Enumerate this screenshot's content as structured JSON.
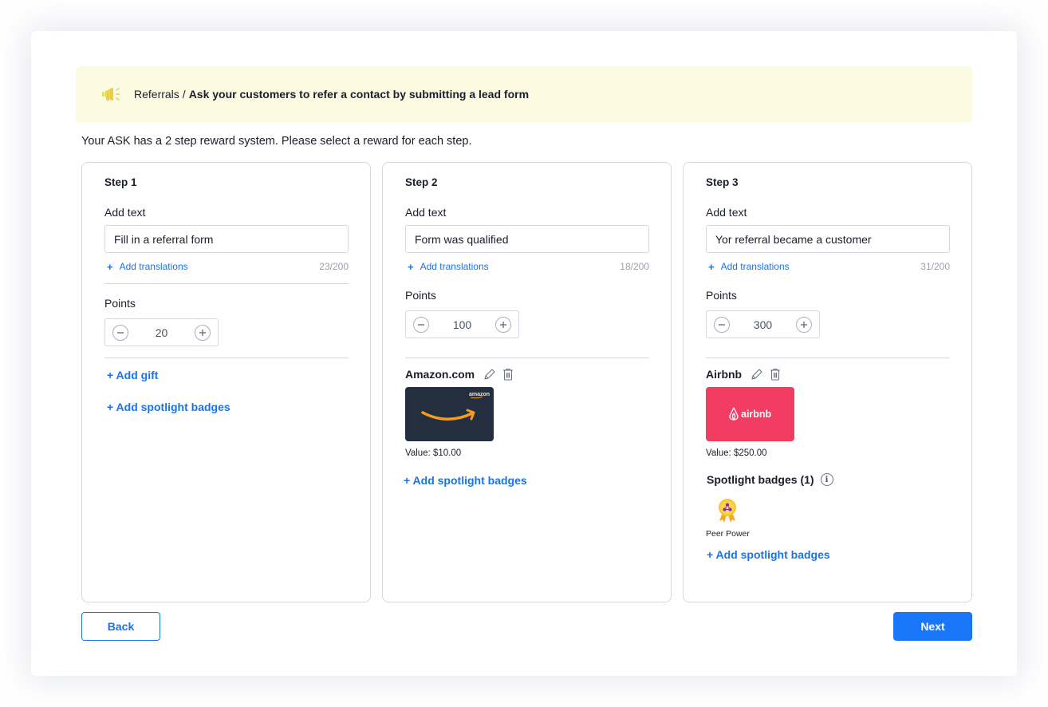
{
  "banner": {
    "icon": "megaphone-icon",
    "breadcrumb_parent": "Referrals",
    "separator": "/",
    "breadcrumb_title": "Ask your customers to refer a contact by submitting a lead form",
    "background": "#fcfbe2"
  },
  "intro_text": "Your ASK has a 2 step reward system. Please select a reward for each step.",
  "steps": [
    {
      "title": "Step 1",
      "text_label": "Add text",
      "text_value": "Fill in a referral form",
      "add_translations": "Add translations",
      "char_count": "23/200",
      "points_label": "Points",
      "points_value": "20",
      "add_gift": "+ Add gift",
      "add_badges": "+ Add spotlight badges"
    },
    {
      "title": "Step 2",
      "text_label": "Add text",
      "text_value": "Form was qualified",
      "add_translations": "Add translations",
      "char_count": "18/200",
      "points_label": "Points",
      "points_value": "100",
      "gift": {
        "name": "Amazon.com",
        "value": "Value: $10.00",
        "card_logo": "amazon",
        "card_color": "#232f3e"
      },
      "add_badges": "+ Add spotlight badges"
    },
    {
      "title": "Step 3",
      "text_label": "Add text",
      "text_value": "Yor referral became a customer",
      "add_translations": "Add translations",
      "char_count": "31/200",
      "points_label": "Points",
      "points_value": "300",
      "gift": {
        "name": "Airbnb",
        "value": "Value: $250.00",
        "card_logo": "airbnb",
        "card_color": "#f23c61"
      },
      "badges_title": "Spotlight badges (1)",
      "badges": [
        {
          "label": "Peer Power",
          "icon": "award-ribbon-icon"
        }
      ],
      "add_badges": "+ Add spotlight badges"
    }
  ],
  "footer": {
    "back_label": "Back",
    "next_label": "Next"
  },
  "colors": {
    "accent": "#1a73e8",
    "primary_button": "#1a76f9",
    "border": "#d6d8e0"
  }
}
